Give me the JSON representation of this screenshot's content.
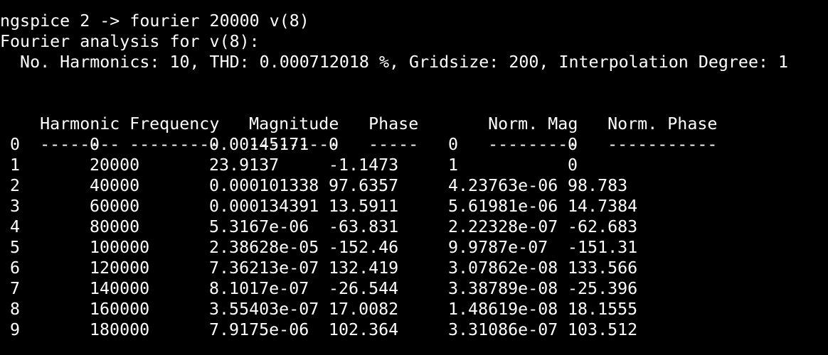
{
  "terminal": {
    "command_line": "ngspice 2 -> fourier 20000 v(8)",
    "analysis_title": "Fourier analysis for v(8):",
    "summary": "  No. Harmonics: 10, THD: 0.000712018 %, Gridsize: 200, Interpolation Degree: 1",
    "table": {
      "headers": [
        "Harmonic",
        "Frequency",
        "Magnitude",
        "Phase",
        "Norm. Mag",
        "Norm. Phase"
      ],
      "separators": [
        "--------",
        "---------",
        "---------",
        "-----",
        "---------",
        "-----------"
      ],
      "rows": [
        [
          "0",
          "0",
          "0.00145171",
          "0",
          "0",
          "0"
        ],
        [
          "1",
          "20000",
          "23.9137",
          "-1.1473",
          "1",
          "0"
        ],
        [
          "2",
          "40000",
          "0.000101338",
          "97.6357",
          "4.23763e-06",
          "98.783"
        ],
        [
          "3",
          "60000",
          "0.000134391",
          "13.5911",
          "5.61981e-06",
          "14.7384"
        ],
        [
          "4",
          "80000",
          "5.3167e-06",
          "-63.831",
          "2.22328e-07",
          "-62.683"
        ],
        [
          "5",
          "100000",
          "2.38628e-05",
          "-152.46",
          "9.9787e-07",
          "-151.31"
        ],
        [
          "6",
          "120000",
          "7.36213e-07",
          "132.419",
          "3.07862e-08",
          "133.566"
        ],
        [
          "7",
          "140000",
          "8.1017e-07",
          "-26.544",
          "3.38789e-08",
          "-25.396"
        ],
        [
          "8",
          "160000",
          "3.55403e-07",
          "17.0082",
          "1.48619e-08",
          "18.1555"
        ],
        [
          "9",
          "180000",
          "7.9175e-06",
          "102.364",
          "3.31086e-07",
          "103.512"
        ]
      ]
    }
  },
  "colors": {
    "background": "#000000",
    "foreground": "#ffffff"
  }
}
